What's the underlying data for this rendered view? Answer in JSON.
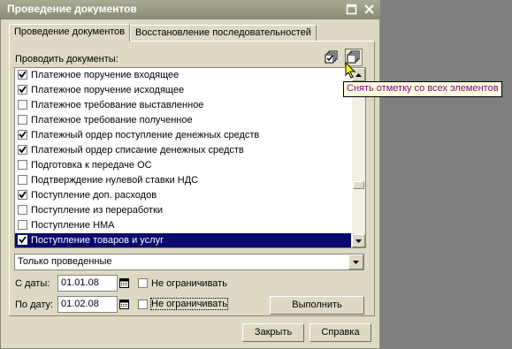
{
  "window": {
    "title": "Проведение документов"
  },
  "tabs": [
    {
      "label": "Проведение документов",
      "active": true
    },
    {
      "label": "Восстановление последовательностей",
      "active": false
    }
  ],
  "list_label": "Проводить документы:",
  "toolbar": {
    "check_all_icon": "check-all-icon",
    "uncheck_all_icon": "uncheck-all-icon"
  },
  "documents": [
    {
      "label": "Платежное поручение входящее",
      "checked": true
    },
    {
      "label": "Платежное поручение исходящее",
      "checked": true
    },
    {
      "label": "Платежное требование выставленное",
      "checked": false
    },
    {
      "label": "Платежное требование полученное",
      "checked": false
    },
    {
      "label": "Платежный ордер поступление денежных средств",
      "checked": true
    },
    {
      "label": "Платежный ордер списание денежных средств",
      "checked": true
    },
    {
      "label": "Подготовка к передаче ОС",
      "checked": false
    },
    {
      "label": "Подтверждение нулевой ставки НДС",
      "checked": false
    },
    {
      "label": "Поступление доп. расходов",
      "checked": true
    },
    {
      "label": "Поступление из переработки",
      "checked": false
    },
    {
      "label": "Поступление НМА",
      "checked": false
    },
    {
      "label": "Поступление товаров и услуг",
      "checked": true,
      "selected": true
    }
  ],
  "filter": {
    "value": "Только проведенные"
  },
  "date_from": {
    "label": "С даты:",
    "value": "01.01.08",
    "no_limit_label": "Не ограничивать",
    "no_limit_checked": false
  },
  "date_to": {
    "label": "По дату:",
    "value": "01.02.08",
    "no_limit_label": "Не ограничивать",
    "no_limit_checked": false
  },
  "buttons": {
    "execute": "Выполнить",
    "close": "Закрыть",
    "help": "Справка"
  },
  "tooltip": "Снять отметку со всех элементов",
  "colors": {
    "selection": "#0a0a6e",
    "tooltip_text": "#800080",
    "window_bg": "#ddd9c3"
  }
}
